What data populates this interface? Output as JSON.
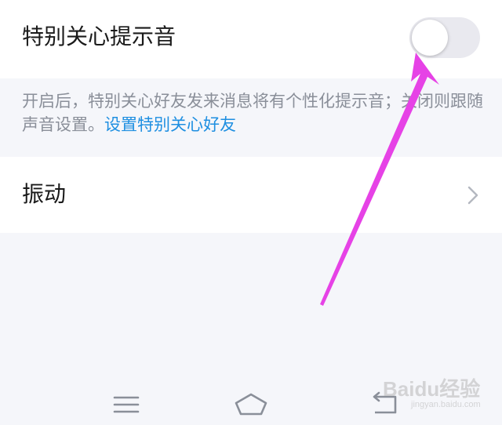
{
  "special_care": {
    "label": "特别关心提示音",
    "toggle_state": "off"
  },
  "description": {
    "text": "开启后，特别关心好友发来消息将有个性化提示音；关闭则跟随声音设置。",
    "link_text": "设置特别关心好友"
  },
  "vibrate": {
    "label": "振动"
  },
  "navbar": {
    "buttons": [
      "menu-icon",
      "home-icon",
      "back-icon"
    ]
  },
  "watermark": {
    "brand": "Baidu经验",
    "sub": "jingyan.baidu.com"
  },
  "colors": {
    "background": "#f5f6fa",
    "link": "#1e8fe1",
    "arrow": "#e642e6",
    "toggle_off": "#e9e9ef"
  }
}
